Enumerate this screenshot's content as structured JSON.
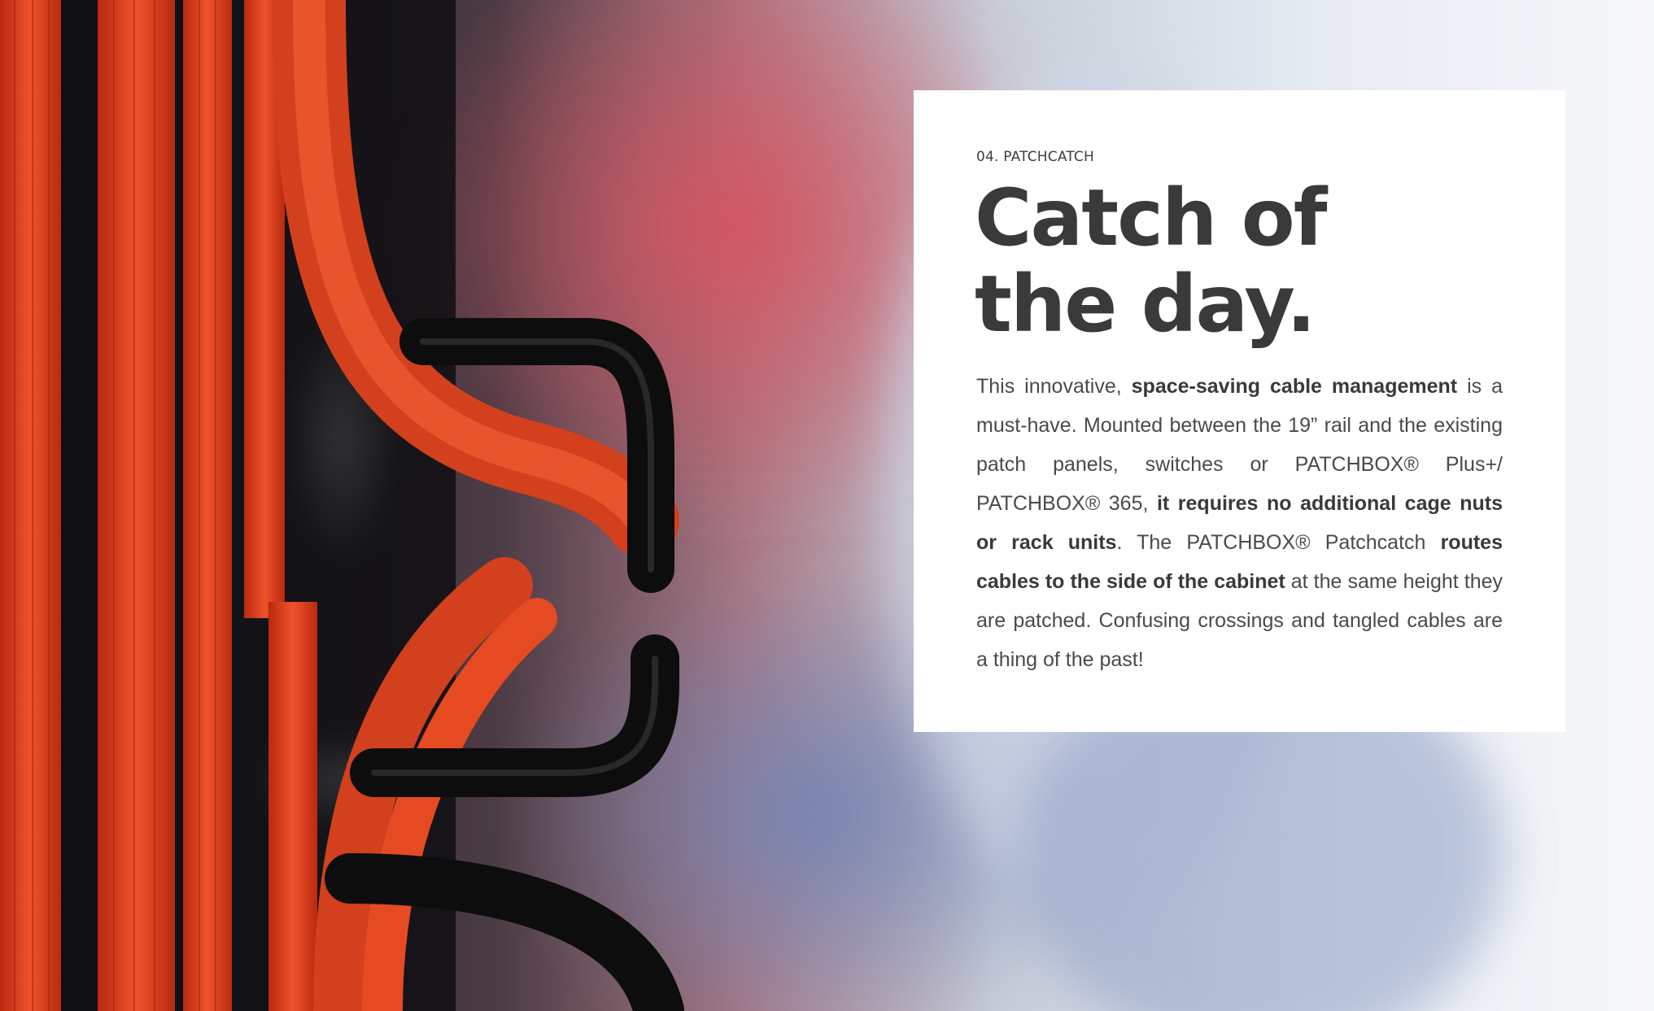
{
  "section_label": "04. PATCHCATCH",
  "headline": {
    "line1": "Catch of",
    "line2": "the day."
  },
  "body": {
    "p1": "This innovative, ",
    "b1": "space-saving cable management",
    "p2": " is a must-have. Mounted between the 19” rail and the existing patch panels, switches or PATCHBOX® Plus+/ PATCHBOX® 365, ",
    "b2": "it requires no additional cage nuts or rack units",
    "p3": ". The PATCHBOX® Patchcatch ",
    "b3": "routes cables to the side of the cabinet",
    "p4": " at the same height they are patched. Confusing crossings and tangled cables are a thing of the past!"
  },
  "colors": {
    "cable_orange": "#e2401c",
    "hook_black": "#121212",
    "headline_text": "#3a3a3a",
    "body_text": "#4a4a4a"
  }
}
